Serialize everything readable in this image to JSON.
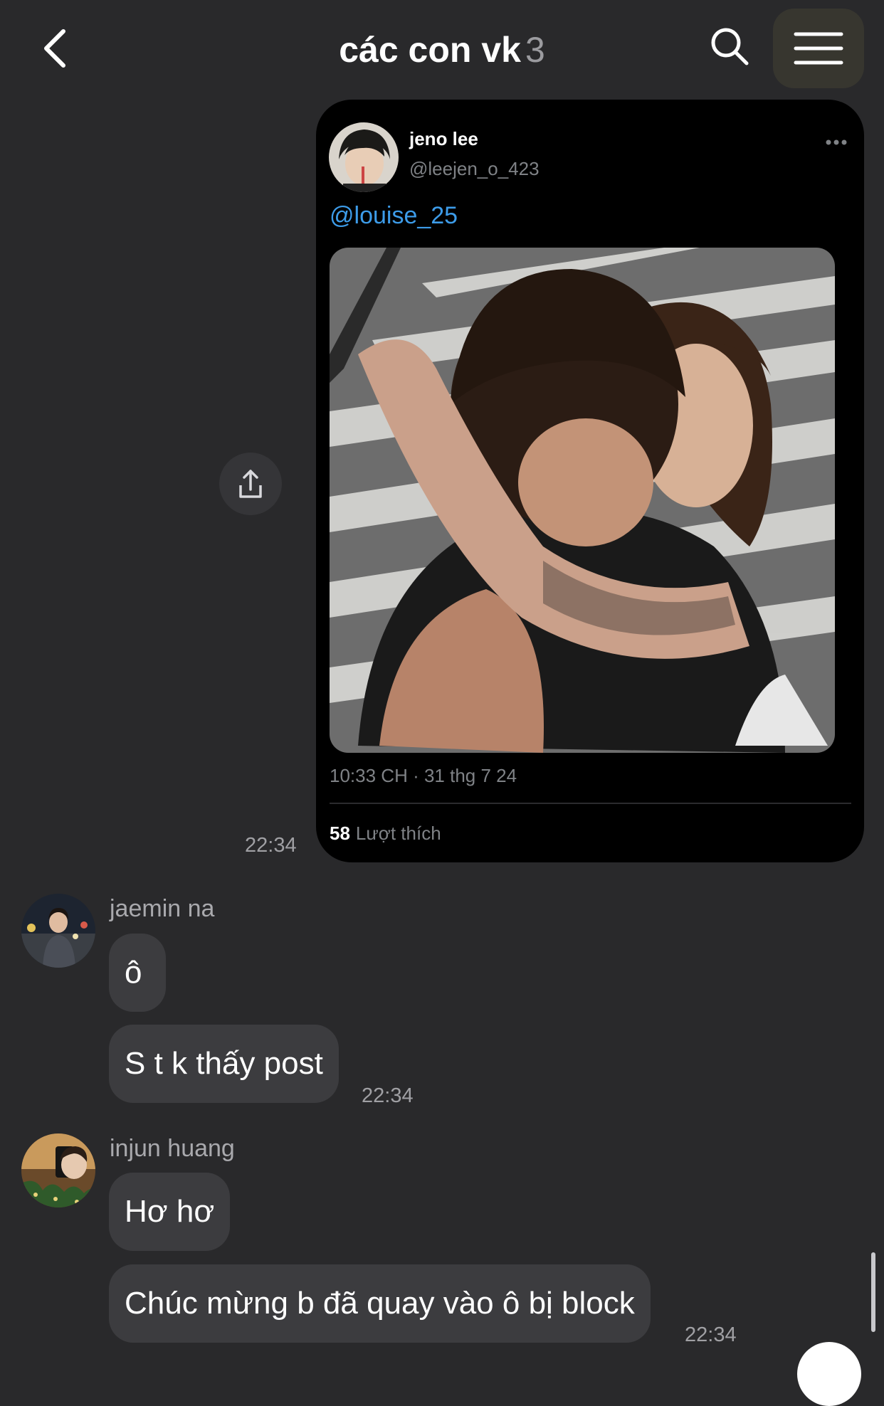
{
  "header": {
    "title": "các con vk",
    "member_count": "3",
    "back_icon": "chevron-left-icon",
    "search_icon": "search-icon",
    "menu_icon": "hamburger-menu-icon"
  },
  "shared_post": {
    "author_name": "jeno lee",
    "author_handle": "@leejen_o_423",
    "mention": "@louise_25",
    "timestamp": "10:33 CH · 31 thg 7 24",
    "likes_count": "58",
    "likes_label": "Lượt thích",
    "more_icon": "more-horizontal-icon",
    "share_icon": "share-upload-icon",
    "sent_time": "22:34",
    "mention_color": "#3d9ce9"
  },
  "messages": [
    {
      "sender": "jaemin na",
      "bubbles": [
        "ô",
        "S t k thấy post"
      ],
      "time": "22:34"
    },
    {
      "sender": "injun huang",
      "bubbles": [
        "Hơ hơ",
        "Chúc mừng b đã quay vào ô bị block"
      ],
      "time": "22:34"
    }
  ],
  "colors": {
    "background": "#29292b",
    "bubble": "#3c3c3f",
    "card": "#000000"
  }
}
